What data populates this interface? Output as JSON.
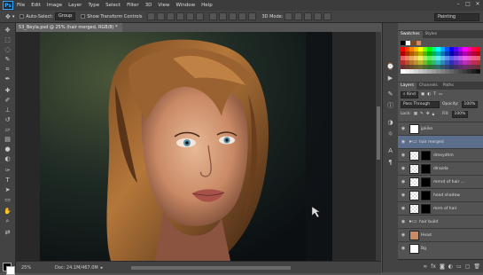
{
  "app": {
    "logo": "Ps"
  },
  "menu": [
    "File",
    "Edit",
    "Image",
    "Layer",
    "Type",
    "Select",
    "Filter",
    "3D",
    "View",
    "Window",
    "Help"
  ],
  "options": {
    "auto_select_label": "Auto-Select:",
    "auto_select_value": "Group",
    "transform_label": "Show Transform Controls",
    "mode_3d": "3D Mode:",
    "workspace": "Painting"
  },
  "document": {
    "tab_title": "53_Beyla.psd @ 25% (hair merged, RGB/8) *",
    "zoom": "25%",
    "info": "Doc: 24.1M/467.0M"
  },
  "panels": {
    "swatches_tabs": [
      "Swatches",
      "Styles"
    ],
    "layers_tabs": [
      "Layers",
      "Channels",
      "Paths"
    ],
    "kind_label": "Kind",
    "blend_mode": "Pass Through",
    "opacity_label": "Opacity:",
    "opacity_value": "100%",
    "lock_label": "Lock:",
    "fill_label": "Fill:",
    "fill_value": "100%"
  },
  "layers": [
    {
      "name": "jpkiko",
      "type": "layer"
    },
    {
      "name": "hair merged",
      "type": "group",
      "selected": true
    },
    {
      "name": "dmeydhm",
      "type": "masked"
    },
    {
      "name": "dlrazda",
      "type": "masked"
    },
    {
      "name": "mmrd of hair ...",
      "type": "masked"
    },
    {
      "name": "head shadow",
      "type": "masked"
    },
    {
      "name": "mrm of hair",
      "type": "masked"
    },
    {
      "name": "hair build",
      "type": "group"
    },
    {
      "name": "Head",
      "type": "photo"
    },
    {
      "name": "Bg",
      "type": "layer"
    }
  ],
  "icons": {
    "tools": [
      "move-icon",
      "marquee-icon",
      "lasso-icon",
      "quick-select-icon",
      "crop-icon",
      "eyedropper-icon",
      "healing-icon",
      "brush-icon",
      "stamp-icon",
      "history-brush-icon",
      "eraser-icon",
      "gradient-icon",
      "blur-icon",
      "dodge-icon",
      "pen-icon",
      "type-icon",
      "path-select-icon",
      "shape-icon",
      "hand-icon",
      "zoom-icon"
    ],
    "dock": [
      "history-icon",
      "actions-icon",
      "brush-presets-icon",
      "info-icon",
      "color-icon",
      "adjust-icon",
      "character-icon",
      "paragraph-icon"
    ]
  },
  "colors": {
    "ui_dark": "#3c3c3c",
    "ui_mid": "#535353",
    "selection": "#5b6e8c",
    "accent": "#31a8ff"
  }
}
